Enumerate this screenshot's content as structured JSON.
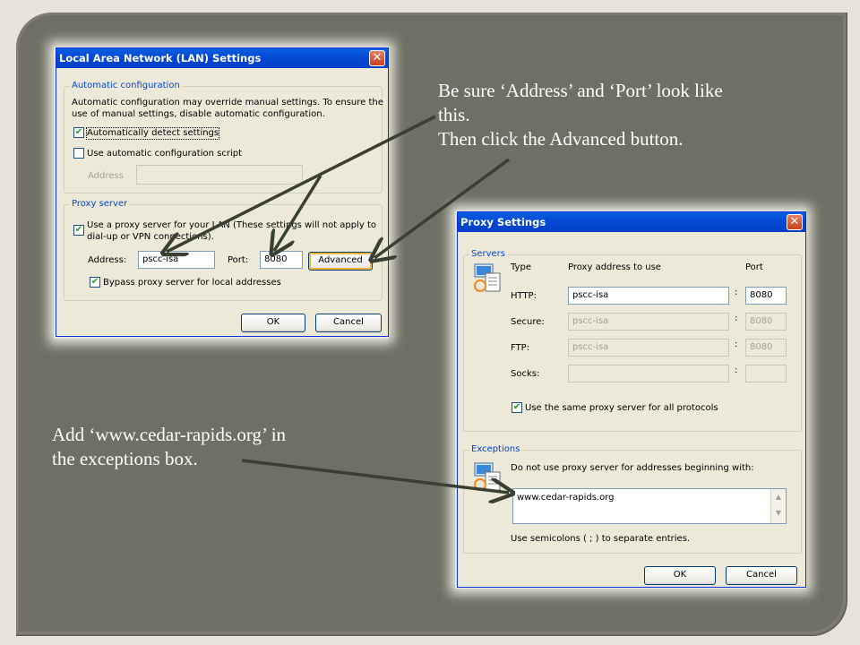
{
  "notes": {
    "top_lines": [
      "Be sure ‘Address’ and ‘Port’ look like",
      "this.",
      "Then click the Advanced button."
    ],
    "bottom_lines": [
      "Add ‘www.cedar-rapids.org’ in",
      "the exceptions box."
    ]
  },
  "lan_dialog": {
    "title": "Local Area Network (LAN) Settings",
    "close": "✕",
    "auto_config": {
      "label": "Automatic configuration",
      "description_lines": [
        "Automatic configuration may override manual settings.  To ensure the",
        "use of manual settings, disable automatic configuration."
      ],
      "auto_detect_label": "Automatically detect settings",
      "auto_detect_checked": true,
      "use_script_label": "Use automatic configuration script",
      "use_script_checked": false,
      "address_label": "Address",
      "address_value": ""
    },
    "proxy_server": {
      "label": "Proxy server",
      "use_proxy_lines": [
        "Use a proxy server for your LAN (These settings will not apply to",
        "dial-up or VPN connections)."
      ],
      "use_proxy_checked": true,
      "address_label": "Address:",
      "address_value": "pscc-isa",
      "port_label": "Port:",
      "port_value": "8080",
      "advanced_label": "Advanced",
      "bypass_label": "Bypass proxy server for local addresses",
      "bypass_checked": true
    },
    "ok_label": "OK",
    "cancel_label": "Cancel"
  },
  "proxy_dialog": {
    "title": "Proxy Settings",
    "close": "✕",
    "servers": {
      "label": "Servers",
      "col_type": "Type",
      "col_address": "Proxy address to use",
      "col_port": "Port",
      "rows": [
        {
          "type": "HTTP:",
          "address": "pscc-isa",
          "port": "8080",
          "enabled": true
        },
        {
          "type": "Secure:",
          "address": "pscc-isa",
          "port": "8080",
          "enabled": false
        },
        {
          "type": "FTP:",
          "address": "pscc-isa",
          "port": "8080",
          "enabled": false
        },
        {
          "type": "Socks:",
          "address": "",
          "port": "",
          "enabled": false
        }
      ],
      "colon": ":",
      "same_proxy_label": "Use the same proxy server for all protocols",
      "same_proxy_checked": true
    },
    "exceptions": {
      "label": "Exceptions",
      "description": "Do not use proxy server for addresses beginning with:",
      "value": "www.cedar-rapids.org",
      "hint": "Use semicolons ( ; ) to separate entries."
    },
    "ok_label": "OK",
    "cancel_label": "Cancel"
  },
  "colors": {
    "slide_background": "#6f6f63",
    "title_bar": "#0449d4",
    "dialog_body": "#ece9d8",
    "group_label": "#0046d5",
    "arrow": "#3a3f33"
  },
  "icons": {
    "check": "✔",
    "network": "network-computer-icon"
  }
}
